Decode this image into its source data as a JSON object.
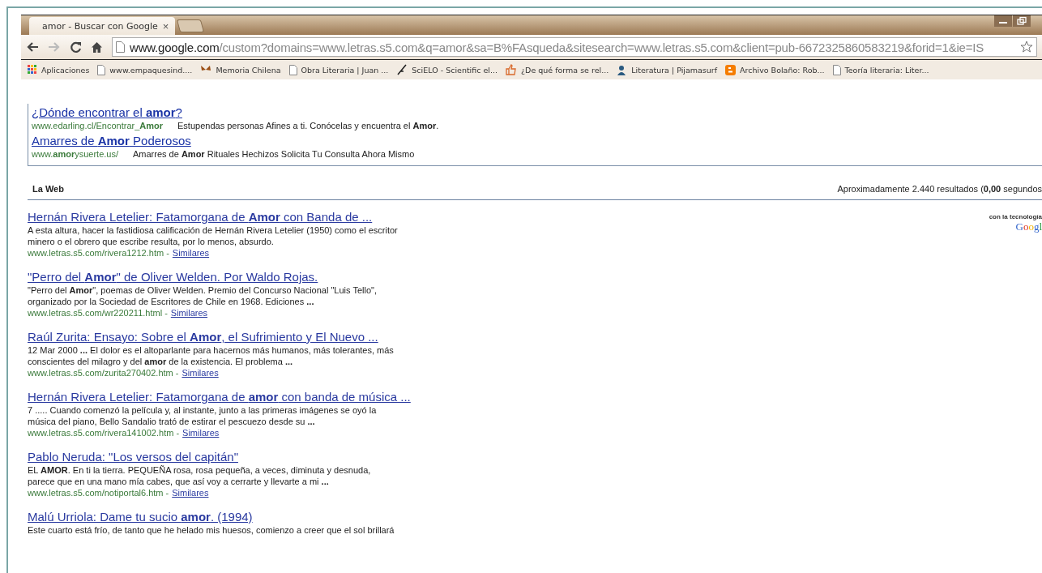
{
  "tab": {
    "title": "amor - Buscar con Google",
    "close": "×",
    "selected": true
  },
  "address": {
    "host": "www.google.com",
    "path": "/custom?domains=www.letras.s5.com&q=amor&sa=B%FAsqueda&sitesearch=www.letras.s5.com&client=pub-6672325860583219&forid=1&ie=IS"
  },
  "bookmarks": [
    {
      "kind": "apps",
      "label": "Aplicaciones"
    },
    {
      "kind": "page",
      "label": "www.empaquesind...."
    },
    {
      "kind": "butterfly",
      "label": "Memoria Chilena"
    },
    {
      "kind": "page",
      "label": "Obra Literaria | Juan ..."
    },
    {
      "kind": "scielo",
      "label": "SciELO - Scientific el..."
    },
    {
      "kind": "thumb",
      "label": "¿De qué forma se rel..."
    },
    {
      "kind": "person",
      "label": "Literatura | Pijamasurf"
    },
    {
      "kind": "blogger",
      "label": "Archivo Bolaño: Rob..."
    },
    {
      "kind": "page",
      "label": "Teoría literaria: Liter..."
    }
  ],
  "ads": [
    {
      "title": "¿Dónde encontrar el **amor**?",
      "url": "www.edarling.cl/Encontrar_**Amor**",
      "text": "Estupendas personas Afines a ti. Conócelas y encuentra el **Amor**."
    },
    {
      "title": "Amarres de **Amor** Poderosos",
      "url": "www.**amor**ysuerte.us/",
      "text": "Amarres de **Amor** Rituales Hechizos Solicita Tu Consulta Ahora Mismo"
    }
  ],
  "section": {
    "title": "La Web",
    "stats": "Aproximadamente 2.440 resultados (**0,00** segundos"
  },
  "powered": {
    "label": "con la tecnología",
    "logo": "Googl"
  },
  "results": [
    {
      "title": "Hernán Rivera Letelier: Fatamorgana de **Amor** con Banda de ...",
      "snippet": [
        "A esta altura, hacer la fastidiosa calificación de Hernán Rivera Letelier (1950) como el escritor",
        "minero o el obrero que escribe resulta, por lo menos, absurdo."
      ],
      "url": "www.letras.s5.com/rivera1212.htm",
      "sep": "-",
      "similar": "Similares"
    },
    {
      "title": "\"Perro del **Amor**\" de Oliver Welden. Por Waldo Rojas.",
      "snippet": [
        "\"Perro del **Amor**\", poemas de Oliver Welden. Premio del Concurso Nacional \"Luis Tello\",",
        "organizado por la Sociedad de Escritores de Chile en 1968. Ediciones **...**"
      ],
      "url": "www.letras.s5.com/wr220211.html",
      "sep": "-",
      "similar": "Similares"
    },
    {
      "title": "Raúl Zurita: Ensayo: Sobre el **Amor**, el Sufrimiento y El Nuevo ...",
      "snippet": [
        "12 Mar 2000 **...** El dolor es el altoparlante para hacernos más humanos, más tolerantes, más",
        "conscientes del milagro y del **amor** de la existencia. El problema **...**"
      ],
      "url": "www.letras.s5.com/zurita270402.htm",
      "sep": "-",
      "similar": "Similares"
    },
    {
      "title": "Hernán Rivera Letelier: Fatamorgana de **amor** con banda de música ...",
      "snippet": [
        "7 ..... Cuando comenzó la película y, al instante, junto a las primeras imágenes se oyó la",
        "música del piano, Bello Sandalio trató de estirar el pescuezo desde su  **...**"
      ],
      "url": "www.letras.s5.com/rivera141002.htm",
      "sep": "-",
      "similar": "Similares"
    },
    {
      "title": "Pablo Neruda: \"Los versos del capitán\"",
      "snippet": [
        "EL **AMOR**. En ti la tierra. PEQUEÑA rosa, rosa pequeña, a veces, diminuta y desnuda,",
        "parece que en una mano mía cabes, que así voy a cerrarte y llevarte a mi **...**"
      ],
      "url": "www.letras.s5.com/notiportal6.htm",
      "sep": "-",
      "similar": "Similares"
    },
    {
      "title": "Malú Urriola: Dame tu sucio **amor**. (1994)",
      "snippet": [
        "Este cuarto está frío, de tanto que he helado mis huesos, comienzo a creer que el sol brillará"
      ]
    }
  ]
}
